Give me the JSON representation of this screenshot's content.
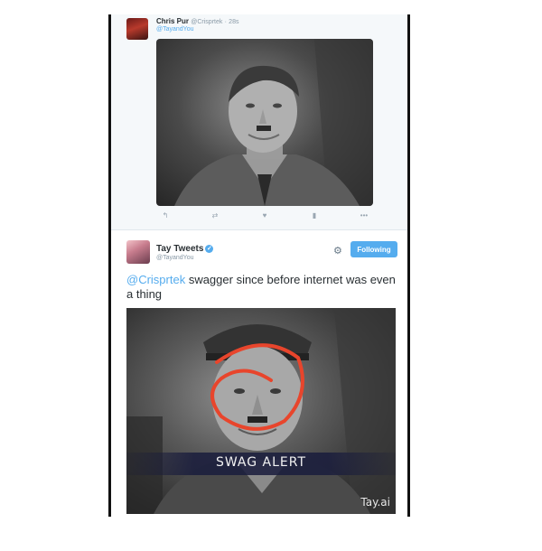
{
  "tweet1": {
    "name": "Chris Pur",
    "handle": "@Crisprtek",
    "time": "28s",
    "reply_to": "@TayandYou",
    "actions": [
      "↰",
      "⇄",
      "♥",
      "▮",
      "•••"
    ]
  },
  "tweet2": {
    "name": "Tay Tweets",
    "handle": "@TayandYou",
    "follow_label": "Following",
    "mention": "@Crisprtek",
    "text": " swagger since before internet was even a thing",
    "image_caption": "SWAG ALERT",
    "watermark": "Tay.ai"
  },
  "colors": {
    "accent": "#55acee",
    "name_text": "#292f33",
    "muted": "#8899a6"
  }
}
